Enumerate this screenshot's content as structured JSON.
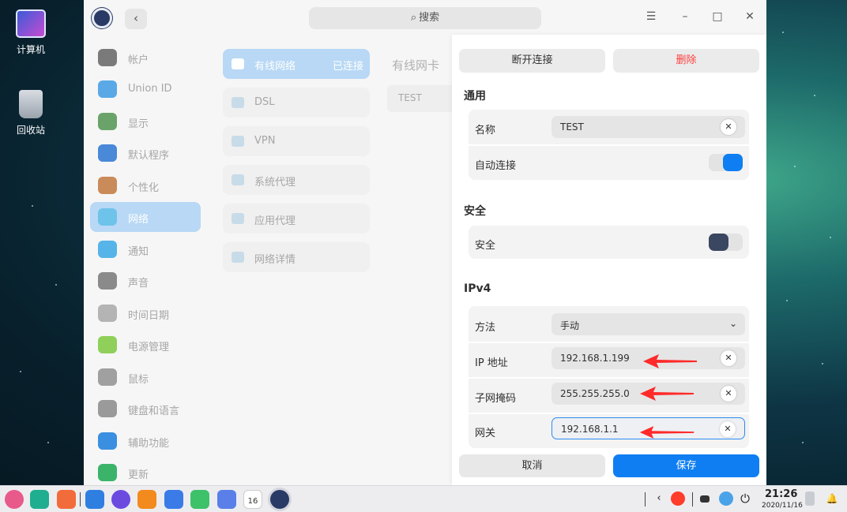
{
  "desktop": {
    "icons": [
      {
        "label": "计算机",
        "icon": "computer-icon"
      },
      {
        "label": "回收站",
        "icon": "trash-icon"
      }
    ]
  },
  "titlebar": {
    "back_glyph": "‹",
    "search_placeholder": "搜索",
    "search_icon_glyph": "⌕",
    "menu_glyph": "☰",
    "minimize_glyph": "–",
    "maximize_glyph": "□",
    "close_glyph": "✕"
  },
  "sidebar": {
    "items": [
      {
        "label": "帐户",
        "icon": "account-icon",
        "color": "#7a7a7a"
      },
      {
        "label": "Union ID",
        "icon": "cloud-icon",
        "color": "#5aa9e6"
      },
      {
        "label": "显示",
        "icon": "display-icon",
        "color": "#6aa36a"
      },
      {
        "label": "默认程序",
        "icon": "default-apps-icon",
        "color": "#4a88d8"
      },
      {
        "label": "个性化",
        "icon": "palette-icon",
        "color": "#c98b5a"
      },
      {
        "label": "网络",
        "icon": "network-globe-icon",
        "color": "#6ec3ea",
        "active": true
      },
      {
        "label": "通知",
        "icon": "notification-icon",
        "color": "#56b4e8"
      },
      {
        "label": "声音",
        "icon": "speaker-icon",
        "color": "#8a8a8a"
      },
      {
        "label": "时间日期",
        "icon": "clock-icon",
        "color": "#b4b4b4"
      },
      {
        "label": "电源管理",
        "icon": "battery-icon",
        "color": "#8fcf5a"
      },
      {
        "label": "鼠标",
        "icon": "mouse-icon",
        "color": "#a0a0a0"
      },
      {
        "label": "键盘和语言",
        "icon": "keyboard-icon",
        "color": "#9a9a9a"
      },
      {
        "label": "辅助功能",
        "icon": "accessibility-icon",
        "color": "#3b8fe0"
      },
      {
        "label": "更新",
        "icon": "update-icon",
        "color": "#3bb46a"
      }
    ]
  },
  "network_menu": {
    "items": [
      {
        "label": "有线网络",
        "status": "已连接",
        "icon": "wired-network-icon",
        "active": true
      },
      {
        "label": "DSL",
        "status": "",
        "icon": "dsl-icon"
      },
      {
        "label": "VPN",
        "status": "",
        "icon": "vpn-icon"
      },
      {
        "label": "系统代理",
        "status": "",
        "icon": "system-proxy-icon"
      },
      {
        "label": "应用代理",
        "status": "",
        "icon": "app-proxy-icon"
      },
      {
        "label": "网络详情",
        "status": "",
        "icon": "info-icon"
      }
    ]
  },
  "wired_card": {
    "title": "有线网卡",
    "connection_name": "TEST"
  },
  "detail_panel": {
    "disconnect_label": "断开连接",
    "delete_label": "删除",
    "general": {
      "title": "通用",
      "name_label": "名称",
      "name_value": "TEST",
      "auto_connect_label": "自动连接",
      "auto_connect": true
    },
    "security": {
      "title": "安全",
      "label": "安全",
      "enabled": false
    },
    "ipv4": {
      "title": "IPv4",
      "method_label": "方法",
      "method_value": "手动",
      "ip_label": "IP 地址",
      "ip_value": "192.168.1.199",
      "mask_label": "子网掩码",
      "mask_value": "255.255.255.0",
      "gateway_label": "网关",
      "gateway_value": "192.168.1.1"
    },
    "clear_glyph": "✕",
    "chevron_glyph": "⌄",
    "cancel_label": "取消",
    "save_label": "保存"
  },
  "taskbar": {
    "apps": [
      {
        "name": "launcher-icon",
        "color": "#e85a8a"
      },
      {
        "name": "multitask-icon",
        "color": "#1fae8f"
      },
      {
        "name": "app-store-icon",
        "color": "#f26b3a"
      },
      {
        "name": "file-manager-icon",
        "color": "#2f7fe0"
      },
      {
        "name": "browser-icon",
        "color": "#6b4ae0"
      },
      {
        "name": "app-store-bag-icon",
        "color": "#f28a1e"
      },
      {
        "name": "photo-viewer-icon",
        "color": "#3a7be8"
      },
      {
        "name": "music-icon",
        "color": "#3dc26a"
      },
      {
        "name": "document-viewer-icon",
        "color": "#5a7fe8"
      },
      {
        "name": "calendar-icon",
        "color": "#ffffff"
      },
      {
        "name": "control-center-icon",
        "color": "#2a3a66"
      }
    ],
    "calendar_day": "16",
    "tray_back_glyph": "‹",
    "power_glyph": "⏻",
    "bell_glyph": "🔔",
    "time": "21:26",
    "date": "2020/11/16"
  },
  "colors": {
    "accent": "#0f7ef2",
    "danger": "#ff3d3d",
    "active_item_bg": "#b8d8f5",
    "arrow": "#ff2a2a"
  }
}
